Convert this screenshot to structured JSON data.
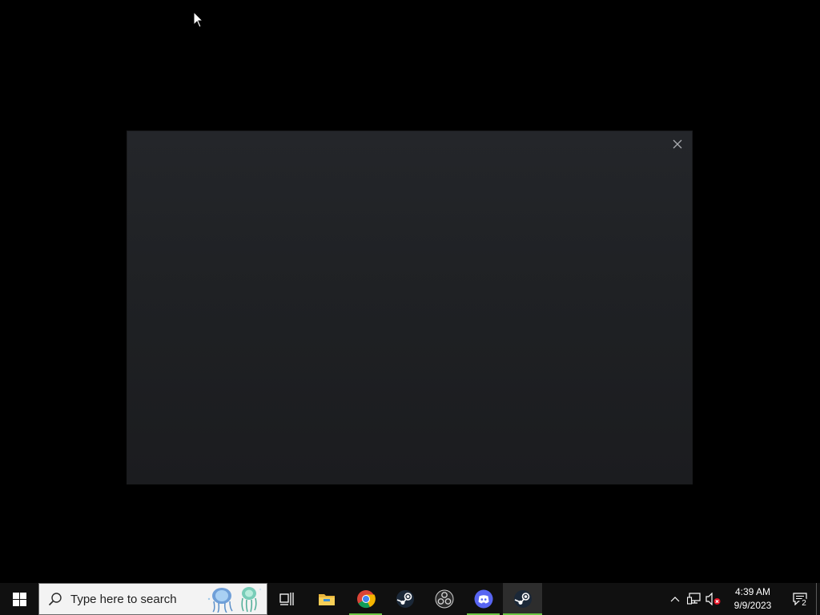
{
  "search": {
    "placeholder": "Type here to search"
  },
  "taskbar": {
    "apps": [
      {
        "name": "Task View",
        "icon": "task-view-icon"
      },
      {
        "name": "File Explorer",
        "icon": "folder-icon"
      },
      {
        "name": "Google Chrome",
        "icon": "chrome-icon",
        "running": true
      },
      {
        "name": "Steam",
        "icon": "steam-icon"
      },
      {
        "name": "OBS Studio",
        "icon": "obs-icon"
      },
      {
        "name": "Discord",
        "icon": "discord-icon",
        "running": true
      },
      {
        "name": "Steam",
        "icon": "steam-icon",
        "running": true,
        "active": true
      }
    ],
    "running_color": "#6cc644"
  },
  "tray": {
    "time": "4:39 AM",
    "date": "9/9/2023",
    "notification_count": "2"
  },
  "colors": {
    "desktop": "#000000",
    "window_bg": "#232427",
    "taskbar": "#101010",
    "accent": "#6cc644"
  }
}
